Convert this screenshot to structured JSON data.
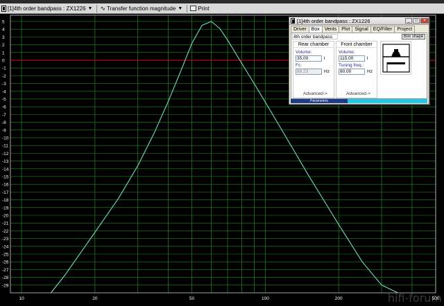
{
  "toolbar": {
    "project_select": "[1]4th order bandpass : ZX1226",
    "plot_select": "Transfer function magnitude",
    "print_label": "Print"
  },
  "dialog": {
    "title": "[1]4th order bandpass : ZX1226",
    "tabs": [
      "Driver",
      "Box",
      "Vents",
      "Plot",
      "Signal",
      "EQ/Filter",
      "Project"
    ],
    "active_tab": "Box",
    "box_type": "4th order bandpass",
    "box_shape_button": "Box shape",
    "rear": {
      "title": "Rear chamber",
      "volume_label": "Volume:",
      "volume_value": "35.00",
      "volume_unit": "l",
      "fc_label": "Fc:",
      "fc_value": "88.23",
      "fc_unit": "Hz",
      "advanced": "Advanced->"
    },
    "front": {
      "title": "Front chamber",
      "volume_label": "Volume:",
      "volume_value": "115.00",
      "volume_unit": "l",
      "tuning_label": "Tuning freq.:",
      "tuning_value": "80.00",
      "tuning_unit": "Hz",
      "advanced": "Advanced->"
    },
    "status_label": "Parameters"
  },
  "watermark": "hifi-forum",
  "chart_data": {
    "type": "line",
    "xscale": "log",
    "xlim": [
      9,
      500
    ],
    "ylim": [
      -30,
      5.8
    ],
    "x_ticks": [
      10,
      20,
      50,
      100,
      200,
      500
    ],
    "y_ticks": [
      5,
      4,
      3,
      2,
      1,
      0,
      -1,
      -2,
      -3,
      -4,
      -5,
      -6,
      -7,
      -8,
      -9,
      -10,
      -11,
      -12,
      -13,
      -14,
      -15,
      -16,
      -17,
      -18,
      -19,
      -20,
      -21,
      -22,
      -23,
      -24,
      -25,
      -26,
      -27,
      -28,
      -29
    ],
    "reference_line_y": 0,
    "reference_line_color": "#e01010",
    "grid_color": "#1f8a1f",
    "trace_color": "#6fe0c8",
    "grid": true,
    "series": [
      {
        "x": [
          13.2,
          15,
          20,
          25,
          30,
          35,
          40,
          45,
          50,
          55,
          60,
          65,
          70,
          80,
          90,
          100,
          120,
          150,
          200,
          250,
          300,
          350
        ],
        "y": [
          -30,
          -27.8,
          -22.2,
          -17.8,
          -13.6,
          -9.4,
          -5.3,
          -1.4,
          2.2,
          4.5,
          5.0,
          4.1,
          2.6,
          -0.4,
          -3.0,
          -5.4,
          -9.6,
          -14.8,
          -21.2,
          -26.0,
          -29.0,
          -30.0
        ]
      }
    ]
  }
}
